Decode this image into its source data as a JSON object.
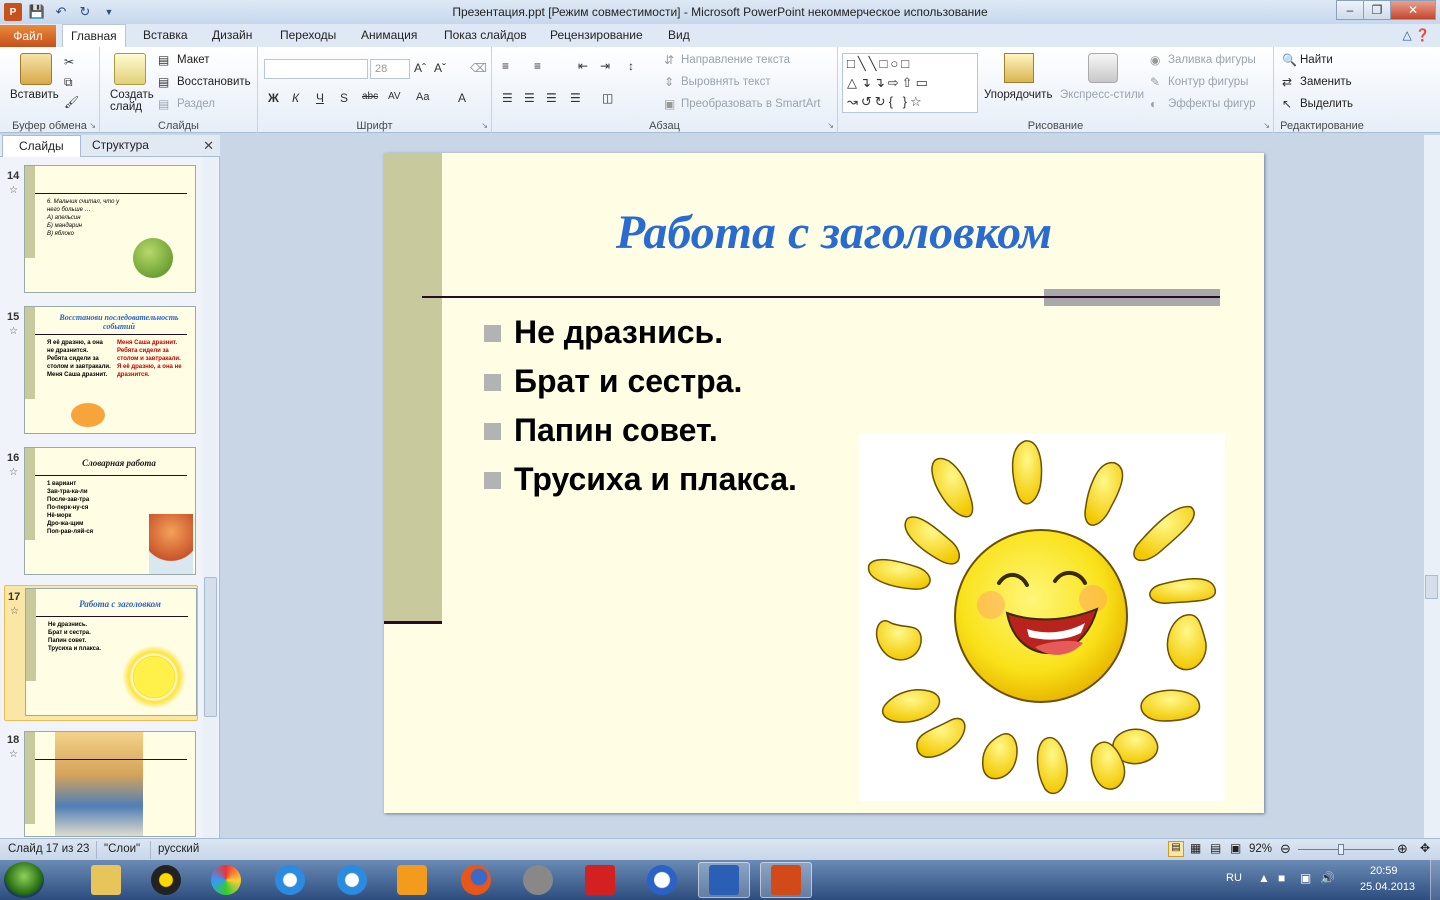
{
  "window": {
    "title": "Презентация.ppt [Режим совместимости]  -  Microsoft PowerPoint некоммерческое использование"
  },
  "tabs": {
    "file": "Файл",
    "items": [
      "Главная",
      "Вставка",
      "Дизайн",
      "Переходы",
      "Анимация",
      "Показ слайдов",
      "Рецензирование",
      "Вид"
    ]
  },
  "ribbon": {
    "clipboard": {
      "label": "Буфер обмена",
      "paste": "Вставить"
    },
    "slides": {
      "label": "Слайды",
      "new_slide": "Создать слайд",
      "layout": "Макет",
      "reset": "Восстановить",
      "section": "Раздел"
    },
    "font": {
      "label": "Шрифт",
      "font_name": "",
      "font_size": "28"
    },
    "paragraph": {
      "label": "Абзац",
      "text_direction": "Направление текста",
      "align_text": "Выровнять текст",
      "smartart": "Преобразовать в SmartArt"
    },
    "drawing": {
      "label": "Рисование",
      "arrange": "Упорядочить",
      "quick_styles": "Экспресс-стили",
      "fill": "Заливка фигуры",
      "outline": "Контур фигуры",
      "effects": "Эффекты фигур"
    },
    "editing": {
      "label": "Редактирование",
      "find": "Найти",
      "replace": "Заменить",
      "select": "Выделить"
    }
  },
  "pane": {
    "tab_slides": "Слайды",
    "tab_outline": "Структура"
  },
  "thumbnails": [
    {
      "num": "14",
      "title": "",
      "lines": [
        "6. Мальчик считал, что у",
        "него больше …",
        "А) апельсин",
        "Б) мандарин",
        "В) яблоко"
      ]
    },
    {
      "num": "15",
      "title": "Восстанови последовательность событий",
      "lines": [
        "Я её дразню, а она не дразнится.",
        "Ребята сидели за столом и завтракали.",
        "Меня Саша дразнит."
      ]
    },
    {
      "num": "16",
      "title": "Словарная работа",
      "lines": [
        "1 вариант",
        "Зав-тра-ка-ли",
        "После-зав-тра",
        "По-перк-ну-ся",
        "Нё-морк",
        "Дро-жа-щим",
        "Поп-рав-ляй-ся"
      ]
    },
    {
      "num": "17",
      "title": "Работа с заголовком",
      "lines": [
        "Не дразнись.",
        "Брат и сестра.",
        "Папин совет.",
        "Трусиха и плакса."
      ]
    },
    {
      "num": "18",
      "title": "",
      "lines": []
    }
  ],
  "slide": {
    "title": "Работа с заголовком",
    "bullets": [
      "Не дразнись.",
      "Брат и сестра.",
      "Папин совет.",
      "Трусиха и плакса."
    ]
  },
  "status": {
    "slide_info": "Слайд 17 из 23",
    "theme": "\"Слои\"",
    "language": "русский",
    "zoom": "92%"
  },
  "taskbar": {
    "lang": "RU",
    "time": "20:59",
    "date": "25.04.2013"
  },
  "colors": {
    "title_blue": "#2a6bd0",
    "slide_bg": "#fffde4",
    "band": "#c9c99e"
  }
}
